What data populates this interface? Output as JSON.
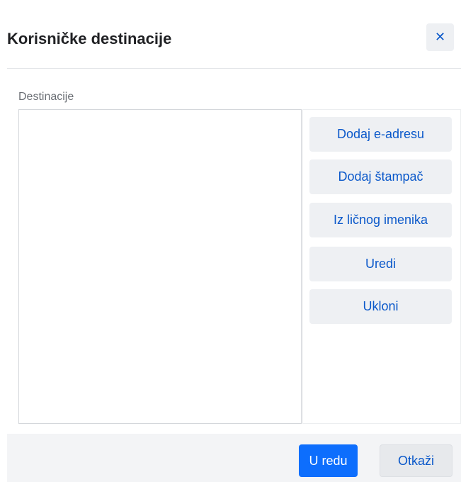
{
  "dialog": {
    "title": "Korisničke destinacije",
    "close_icon": "close-icon",
    "section_label": "Destinacije",
    "destinations": [],
    "actions": [
      {
        "label": "Dodaj e-adresu"
      },
      {
        "label": "Dodaj štampač"
      },
      {
        "label": "Iz ličnog imenika"
      },
      {
        "label": "Uredi"
      },
      {
        "label": "Ukloni"
      }
    ],
    "footer": {
      "ok_label": "U redu",
      "cancel_label": "Otkaži"
    },
    "colors": {
      "primary": "#0d6efd",
      "link": "#0a58ca",
      "button_bg": "#eef0f3"
    }
  }
}
